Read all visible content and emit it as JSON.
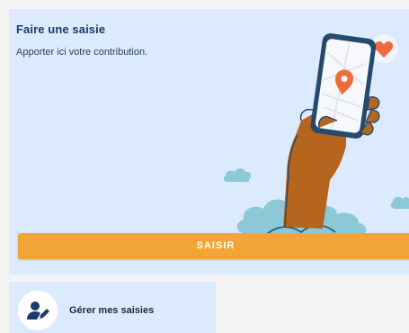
{
  "main_card": {
    "title": "Faire une saisie",
    "subtitle": "Apporter ici votre contribution.",
    "button_label": "SAISIR",
    "accent_color": "#f0a535",
    "background_color": "#dbeafc"
  },
  "secondary_card": {
    "label": "Gérer mes saisies",
    "icon": "user-edit-icon"
  },
  "illustration": {
    "icons": [
      "hand-holding-phone-icon",
      "map-pin-icon",
      "heart-icon",
      "cloud-icon"
    ]
  }
}
